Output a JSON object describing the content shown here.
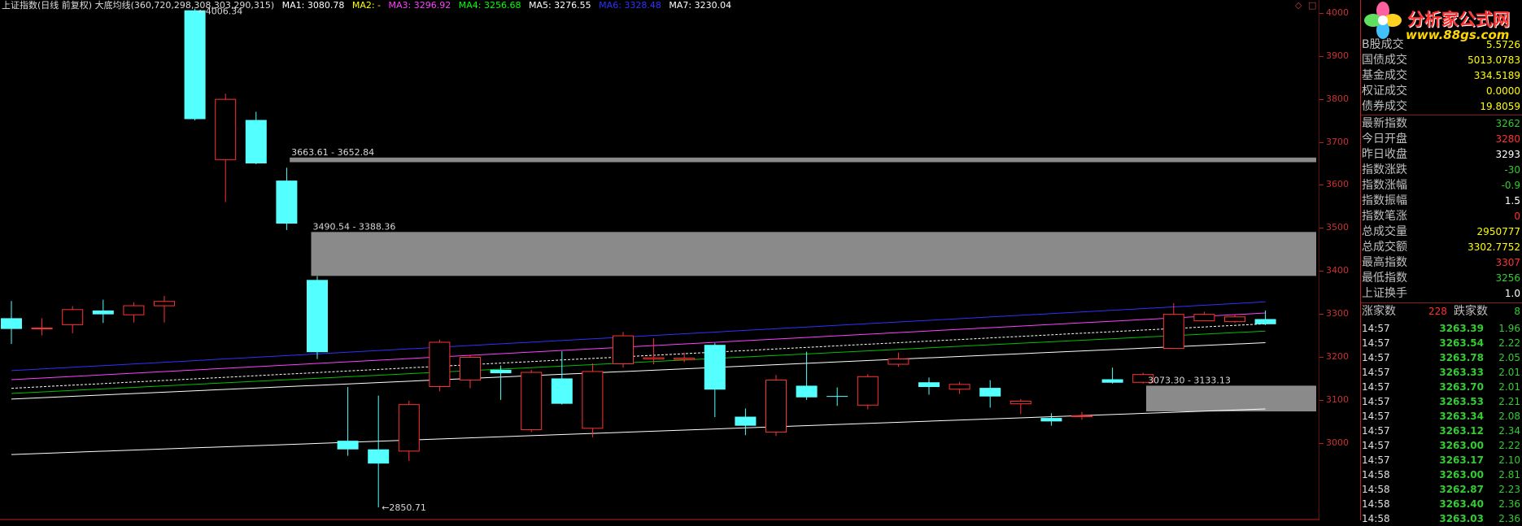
{
  "header": {
    "title": "上证指数(日线 前复权) 大底均线(360,720,298,308,303,290,315)",
    "ma": [
      {
        "label": "MA1: 3080.78",
        "color": "#ffffff"
      },
      {
        "label": "MA2: -",
        "color": "#ffff00"
      },
      {
        "label": "MA3: 3296.92",
        "color": "#ff40ff"
      },
      {
        "label": "MA4: 3256.68",
        "color": "#00ff00"
      },
      {
        "label": "MA5: 3276.55",
        "color": "#ffffff"
      },
      {
        "label": "MA6: 3328.48",
        "color": "#2020ff"
      },
      {
        "label": "MA7: 3230.04",
        "color": "#ffffff"
      }
    ]
  },
  "corner_icons": [
    "◇",
    "□"
  ],
  "logo": {
    "title": "分析家公式网",
    "url": "www.88gs.com"
  },
  "chart_data": {
    "type": "candlestick",
    "ylim": [
      2820,
      4030
    ],
    "yticks": [
      3000,
      3100,
      3200,
      3300,
      3400,
      3500,
      3600,
      3700,
      3800,
      3900,
      4000
    ],
    "colors": {
      "up": "#ff3232",
      "down": "#54ffff"
    },
    "candles": [
      {
        "o": 3290,
        "c": 3265,
        "h": 3330,
        "l": 3230
      },
      {
        "o": 3267,
        "c": 3268,
        "h": 3290,
        "l": 3250
      },
      {
        "o": 3274,
        "c": 3311,
        "h": 3318,
        "l": 3255
      },
      {
        "o": 3308,
        "c": 3299,
        "h": 3333,
        "l": 3279
      },
      {
        "o": 3297,
        "c": 3320,
        "h": 3327,
        "l": 3280
      },
      {
        "o": 3318,
        "c": 3330,
        "h": 3342,
        "l": 3280
      },
      {
        "o": 4006,
        "c": 3753,
        "h": 4010,
        "l": 3750
      },
      {
        "o": 3658,
        "c": 3800,
        "h": 3812,
        "l": 3560
      },
      {
        "o": 3751,
        "c": 3650,
        "h": 3770,
        "l": 3648
      },
      {
        "o": 3610,
        "c": 3510,
        "h": 3640,
        "l": 3495
      },
      {
        "o": 3379,
        "c": 3211,
        "h": 3388,
        "l": 3195
      },
      {
        "o": 3005,
        "c": 2985,
        "h": 3130,
        "l": 2970
      },
      {
        "o": 2985,
        "c": 2952,
        "h": 3110,
        "l": 2850
      },
      {
        "o": 2980,
        "c": 3090,
        "h": 3098,
        "l": 2958
      },
      {
        "o": 3130,
        "c": 3235,
        "h": 3240,
        "l": 3120
      },
      {
        "o": 3145,
        "c": 3200,
        "h": 3205,
        "l": 3127
      },
      {
        "o": 3170,
        "c": 3162,
        "h": 3180,
        "l": 3100
      },
      {
        "o": 3030,
        "c": 3165,
        "h": 3170,
        "l": 3025
      },
      {
        "o": 3150,
        "c": 3091,
        "h": 3213,
        "l": 3089
      },
      {
        "o": 3033,
        "c": 3167,
        "h": 3185,
        "l": 3013
      },
      {
        "o": 3183,
        "c": 3250,
        "h": 3258,
        "l": 3175
      },
      {
        "o": 3194,
        "c": 3199,
        "h": 3243,
        "l": 3183
      },
      {
        "o": 3193,
        "c": 3198,
        "h": 3210,
        "l": 3188
      },
      {
        "o": 3228,
        "c": 3124,
        "h": 3232,
        "l": 3060
      },
      {
        "o": 3061,
        "c": 3040,
        "h": 3080,
        "l": 3018
      },
      {
        "o": 3024,
        "c": 3147,
        "h": 3158,
        "l": 3016
      },
      {
        "o": 3133,
        "c": 3106,
        "h": 3212,
        "l": 3100
      },
      {
        "o": 3109,
        "c": 3108,
        "h": 3129,
        "l": 3086
      },
      {
        "o": 3087,
        "c": 3155,
        "h": 3160,
        "l": 3078
      },
      {
        "o": 3182,
        "c": 3196,
        "h": 3210,
        "l": 3177
      },
      {
        "o": 3141,
        "c": 3130,
        "h": 3152,
        "l": 3112
      },
      {
        "o": 3124,
        "c": 3137,
        "h": 3142,
        "l": 3114
      },
      {
        "o": 3128,
        "c": 3108,
        "h": 3146,
        "l": 3082
      },
      {
        "o": 3090,
        "c": 3098,
        "h": 3102,
        "l": 3067
      },
      {
        "o": 3058,
        "c": 3050,
        "h": 3069,
        "l": 3040
      },
      {
        "o": 3062,
        "c": 3064,
        "h": 3072,
        "l": 3054
      },
      {
        "o": 3148,
        "c": 3140,
        "h": 3175,
        "l": 3138
      },
      {
        "o": 3140,
        "c": 3160,
        "h": 3163,
        "l": 3138
      },
      {
        "o": 3219,
        "c": 3300,
        "h": 3325,
        "l": 3219
      },
      {
        "o": 3283,
        "c": 3300,
        "h": 3305,
        "l": 3283
      },
      {
        "o": 3281,
        "c": 3294,
        "h": 3298,
        "l": 3279
      },
      {
        "o": 3288,
        "c": 3276,
        "h": 3308,
        "l": 3274
      }
    ],
    "lines": [
      {
        "color": "#3030ff",
        "y1": 3168,
        "y2": 3328
      },
      {
        "color": "#ff40ff",
        "y1": 3147,
        "y2": 3302
      },
      {
        "color": "#ffffff",
        "y1": 3127,
        "y2": 3277,
        "dashed": true
      },
      {
        "color": "#00c000",
        "y1": 3115,
        "y2": 3260
      },
      {
        "color": "#ffffff",
        "y1": 3102,
        "y2": 3233
      },
      {
        "color": "#ffffff",
        "y1": 2973,
        "y2": 3079
      }
    ],
    "zones": [
      {
        "from": 3652.84,
        "to": 3663.61,
        "start_index": 9.6,
        "label": "3663.61 - 3652.84"
      },
      {
        "from": 3388.36,
        "to": 3490.54,
        "start_index": 10.3,
        "label": "3490.54 - 3388.36"
      },
      {
        "from": 3073.3,
        "to": 3133.13,
        "start_index": 37.6,
        "label": "3073.30 - 3133.13"
      }
    ],
    "annotations": [
      {
        "text": "4006.34",
        "index": 6,
        "value": 4006.34
      },
      {
        "text": "2850.71",
        "index": 12,
        "value": 2850.71
      }
    ]
  },
  "quote": {
    "rows": [
      {
        "label": "B股成交",
        "value": "5.5726",
        "color": "#ffff00"
      },
      {
        "label": "国债成交",
        "value": "5013.0783",
        "color": "#ffff00"
      },
      {
        "label": "基金成交",
        "value": "334.5189",
        "color": "#ffff00"
      },
      {
        "label": "权证成交",
        "value": "0.0000",
        "color": "#ffff00"
      },
      {
        "label": "债券成交",
        "value": "19.8059",
        "color": "#ffff00"
      },
      {
        "label": "最新指数",
        "value": "3262",
        "color": "#33cc33"
      },
      {
        "label": "今日开盘",
        "value": "3280",
        "color": "#ff3232"
      },
      {
        "label": "昨日收盘",
        "value": "3293",
        "color": "#ffffff"
      },
      {
        "label": "指数涨跌",
        "value": "-30",
        "color": "#33cc33"
      },
      {
        "label": "指数涨幅",
        "value": "-0.9",
        "color": "#33cc33"
      },
      {
        "label": "指数振幅",
        "value": "1.5",
        "color": "#ffffff"
      },
      {
        "label": "指数笔涨",
        "value": "0",
        "color": "#ff3232"
      },
      {
        "label": "总成交量",
        "value": "2950777",
        "color": "#ffff00"
      },
      {
        "label": "总成交额",
        "value": "3302.7752",
        "color": "#ffff00"
      },
      {
        "label": "最高指数",
        "value": "3307",
        "color": "#ff3232"
      },
      {
        "label": "最低指数",
        "value": "3256",
        "color": "#33cc33"
      },
      {
        "label": "上证换手",
        "value": "1.0",
        "color": "#ffffff"
      }
    ],
    "adv_label": "涨家数",
    "adv_value": "228",
    "dec_label": "跌家数",
    "dec_value": "8",
    "ticks": [
      {
        "time": "14:57",
        "price": "3263.39",
        "vol": "1.96"
      },
      {
        "time": "14:57",
        "price": "3263.54",
        "vol": "2.22"
      },
      {
        "time": "14:57",
        "price": "3263.78",
        "vol": "2.05"
      },
      {
        "time": "14:57",
        "price": "3263.33",
        "vol": "2.01"
      },
      {
        "time": "14:57",
        "price": "3263.70",
        "vol": "2.01"
      },
      {
        "time": "14:57",
        "price": "3263.53",
        "vol": "2.21"
      },
      {
        "time": "14:57",
        "price": "3263.34",
        "vol": "2.08"
      },
      {
        "time": "14:57",
        "price": "3263.12",
        "vol": "2.34"
      },
      {
        "time": "14:57",
        "price": "3263.00",
        "vol": "2.22"
      },
      {
        "time": "14:57",
        "price": "3263.17",
        "vol": "2.10"
      },
      {
        "time": "14:58",
        "price": "3263.00",
        "vol": "2.81"
      },
      {
        "time": "14:58",
        "price": "3262.87",
        "vol": "2.23"
      },
      {
        "time": "14:58",
        "price": "3263.40",
        "vol": "2.36"
      },
      {
        "time": "14:58",
        "price": "3263.03",
        "vol": "2.36"
      }
    ]
  }
}
